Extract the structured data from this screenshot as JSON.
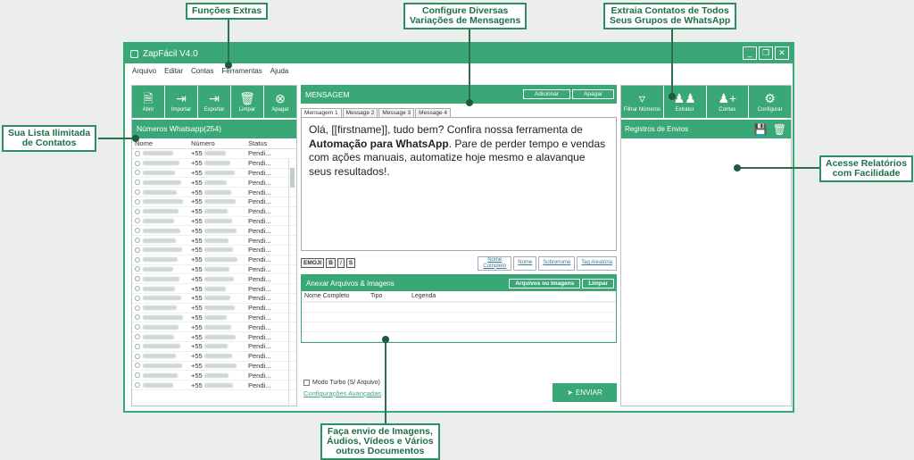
{
  "callouts": {
    "funcoes": "Funções Extras",
    "configure_1": "Configure Diversas",
    "configure_2": "Variações de Mensagens",
    "extraia_1": "Extraia Contatos de Todos",
    "extraia_2": "Seus Grupos de WhatsApp",
    "lista_1": "Sua Lista Ilimitada",
    "lista_2": "de Contatos",
    "relatorios_1": "Acesse Relatórios",
    "relatorios_2": "com Facilidade",
    "envio_1": "Faça envio de Imagens,",
    "envio_2": "Áudios, Vídeos e Vários",
    "envio_3": "outros Documentos"
  },
  "window": {
    "title": "ZapFácil  V4.0",
    "controls": [
      "_",
      "❐",
      "✕"
    ]
  },
  "menu": [
    "Arquivo",
    "Editar",
    "Contas",
    "Ferramentas",
    "Ajuda"
  ],
  "left_toolbar": [
    {
      "label": "Abrir",
      "icon": "file-icon"
    },
    {
      "label": "Importar",
      "icon": "import-icon"
    },
    {
      "label": "Exportar",
      "icon": "export-icon"
    },
    {
      "label": "Limpar",
      "icon": "trash-icon"
    },
    {
      "label": "Apagar",
      "icon": "close-circle-icon"
    }
  ],
  "contacts": {
    "header": "Números Whatsapp(254)",
    "columns": [
      "Nome",
      "Número",
      "Status"
    ],
    "rows": [
      {
        "number": "+55",
        "status": "Pendi..."
      },
      {
        "number": "+55",
        "status": "Pendi..."
      },
      {
        "number": "+55",
        "status": "Pendi..."
      },
      {
        "number": "+55",
        "status": "Pendi..."
      },
      {
        "number": "+55",
        "status": "Pendi..."
      },
      {
        "number": "+55",
        "status": "Pendi..."
      },
      {
        "number": "+55",
        "status": "Pendi..."
      },
      {
        "number": "+55",
        "status": "Pendi..."
      },
      {
        "number": "+55",
        "status": "Pendi..."
      },
      {
        "number": "+55",
        "status": "Pendi..."
      },
      {
        "number": "+55",
        "status": "Pendi..."
      },
      {
        "number": "+55",
        "status": "Pendi..."
      },
      {
        "number": "+55",
        "status": "Pendi..."
      },
      {
        "number": "+55",
        "status": "Pendi..."
      },
      {
        "number": "+55",
        "status": "Pendi..."
      },
      {
        "number": "+55",
        "status": "Pendi..."
      },
      {
        "number": "+55",
        "status": "Pendi..."
      },
      {
        "number": "+55",
        "status": "Pendi..."
      },
      {
        "number": "+55",
        "status": "Pendi..."
      },
      {
        "number": "+55",
        "status": "Pendi..."
      },
      {
        "number": "+55",
        "status": "Pendi..."
      },
      {
        "number": "+55",
        "status": "Pendi..."
      },
      {
        "number": "+55",
        "status": "Pendi..."
      },
      {
        "number": "+55",
        "status": "Pendi..."
      },
      {
        "number": "+55",
        "status": "Pendi..."
      }
    ]
  },
  "message": {
    "header": "MENSAGEM",
    "add_label": "Adicionar",
    "delete_label": "Apagar",
    "tabs": [
      "Mensagem 1",
      "Message 2",
      "Message 3",
      "Message 4"
    ],
    "text_part1": "Olá, [[firstname]], tudo bem? Confira nossa ferramenta de ",
    "text_bold": "Automação para WhatsApp",
    "text_part2": ". Pare de perder tempo e vendas com ações manuais, automatize hoje mesmo e alavanque seus resultados!.",
    "format_buttons": [
      "EMOJI",
      "B",
      "I",
      "S"
    ],
    "tags": [
      "Nome Completo",
      "Nome",
      "Sobrenome",
      "Tag Aleatória"
    ]
  },
  "attachments": {
    "header": "Anexar Arquivos & Imagens",
    "files_label": "Arquivos ou Imagens",
    "clear_label": "Limpar",
    "columns": [
      "Nome Completo",
      "Tipo",
      "Legenda"
    ]
  },
  "turbo_label": "Modo Turbo (S/ Arquivo)",
  "advanced_label": "Configurações Avançadas",
  "send_label": "ENVIAR",
  "right_toolbar": [
    {
      "label": "Filtrar Números",
      "icon": "filter-icon"
    },
    {
      "label": "Extrator",
      "icon": "group-icon"
    },
    {
      "label": "Contas",
      "icon": "add-user-icon"
    },
    {
      "label": "Configurar",
      "icon": "gear-icon"
    }
  ],
  "reports": {
    "header": "Registros de Envios"
  },
  "colors": {
    "accent": "#3aa876",
    "callout_border": "#2f8f64"
  }
}
